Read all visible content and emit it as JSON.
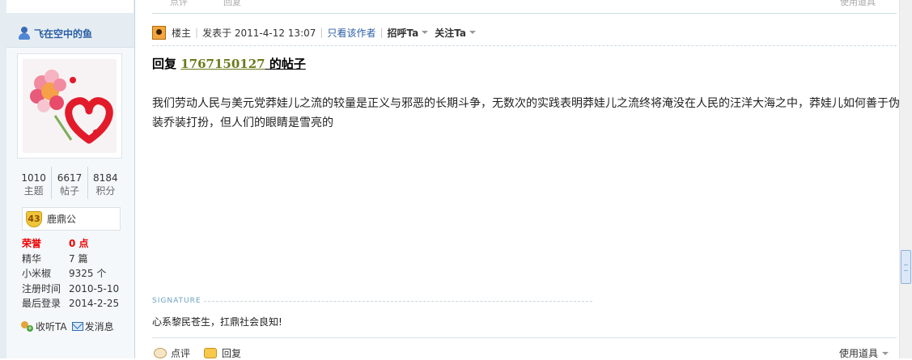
{
  "user": {
    "name": "飞在空中的鱼",
    "stats": [
      {
        "value": "1010",
        "label": "主题"
      },
      {
        "value": "6617",
        "label": "帖子"
      },
      {
        "value": "8184",
        "label": "积分"
      }
    ],
    "rank_level": "43",
    "rank_name": "鹿鼎公",
    "info": [
      {
        "key": "荣誉",
        "value": "0 点"
      },
      {
        "key": "精华",
        "value": "7 篇"
      },
      {
        "key": "小米椒",
        "value": "9325 个"
      },
      {
        "key": "注册时间",
        "value": "2010-5-10"
      },
      {
        "key": "最后登录",
        "value": "2014-2-25"
      }
    ],
    "follow_label": "收听TA",
    "message_label": "发消息"
  },
  "post": {
    "owner_label": "楼主",
    "posted_at": "发表于 2011-4-12 13:07",
    "only_author": "只看该作者",
    "greet": "招呼Ta",
    "follow": "关注Ta",
    "reply_prefix": "回复 ",
    "reply_pid": "1767150127",
    "reply_suffix": " 的帖子",
    "body": "我们劳动人民与美元党莽娃儿之流的较量是正义与邪恶的长期斗争，无数次的实践表明莽娃儿之流终将淹没在人民的汪洋大海之中，莽娃儿如何善于伪装乔装打扮，但人们的眼睛是雪亮的",
    "signature_label": "SIGNATURE",
    "signature": "心系黎民苍生，扛鼎社会良知!"
  },
  "footer": {
    "rate_label": "点评",
    "reply_label": "回复",
    "tools_label": "使用道具"
  },
  "prev_footer": {
    "rate_label": "点评",
    "reply_label": "回复",
    "tools_label": "使用道具"
  },
  "colors": {
    "sidebar_bg": "#e5edf2",
    "link": "#2b5fa6",
    "highlight": "#e00000",
    "pid": "#6b7a1b"
  }
}
